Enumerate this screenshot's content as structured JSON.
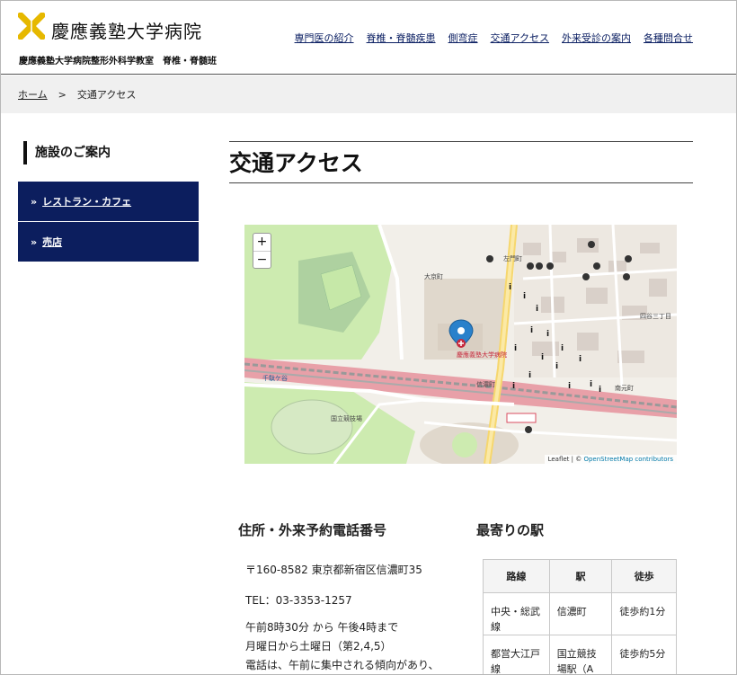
{
  "header": {
    "logo_text": "慶應義塾大学病院",
    "sub_title": "慶應義塾大学病院整形外科学教室　脊椎・脊髄班",
    "nav": [
      "専門医の紹介",
      "脊椎・脊髄疾患",
      "側弯症",
      "交通アクセス",
      "外来受診の案内",
      "各種問合せ"
    ]
  },
  "breadcrumb": {
    "home": "ホーム",
    "separator": ">",
    "current": "交通アクセス"
  },
  "sidebar": {
    "title": "施設のご案内",
    "items": [
      {
        "label": "レストラン・カフェ"
      },
      {
        "label": "売店"
      }
    ]
  },
  "page": {
    "title": "交通アクセス"
  },
  "map": {
    "zoom_in": "+",
    "zoom_out": "−",
    "attribution_prefix": "Leaflet | © ",
    "attribution_link": "OpenStreetMap contributors",
    "labels": {
      "hospital": "慶應義塾大学病院",
      "shinanomachi": "信濃町",
      "daikyocho": "大京町",
      "yotsuya_sanchome": "四谷三丁目",
      "sendagaya": "千駄ケ谷",
      "kokuritsu": "国立競技場",
      "sanaecho": "左門町",
      "minamimoto": "南元町"
    }
  },
  "address": {
    "heading": "住所・外来予約電話番号",
    "postal": "〒160-8582 東京都新宿区信濃町35",
    "tel": "TEL：03-3353-1257",
    "hours": "午前8時30分 から 午後4時まで",
    "days": "月曜日から土曜日（第2,4,5）",
    "note": "電話は、午前に集中される傾向があり、"
  },
  "station": {
    "heading": "最寄りの駅",
    "columns": [
      "路線",
      "駅",
      "徒歩"
    ],
    "rows": [
      {
        "line": "中央・総武線",
        "station": "信濃町",
        "walk": "徒歩約1分"
      },
      {
        "line": "都営大江戸線",
        "station": "国立競技場駅（A",
        "walk": "徒歩約5分"
      }
    ]
  },
  "colors": {
    "nav_text": "#0c2063",
    "side_button_bg": "#0c1e5e",
    "logo_gold": "#e6b800",
    "map_pin": "#2a81cb"
  }
}
